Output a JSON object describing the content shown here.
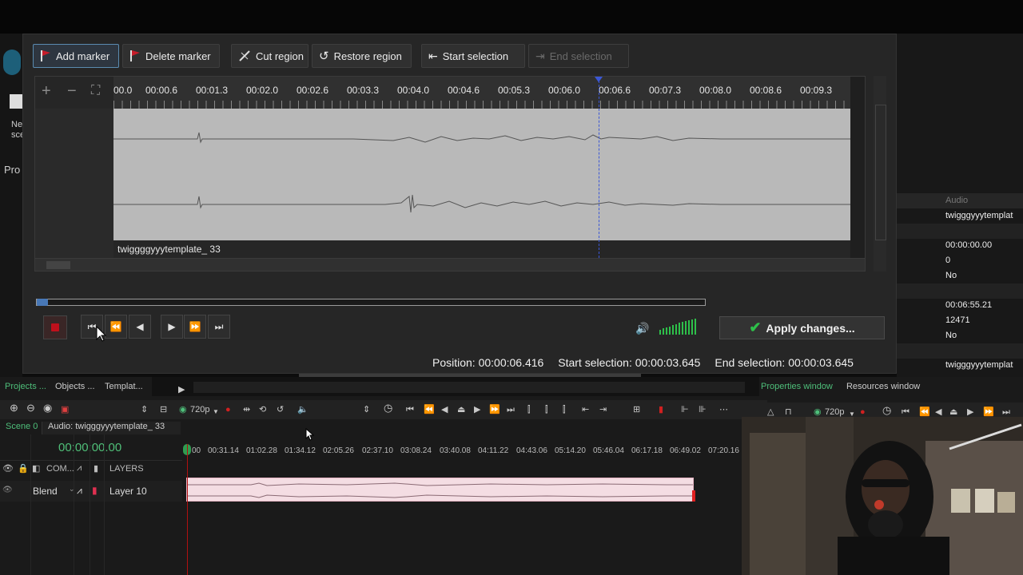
{
  "bg_left": {
    "sidebar_text": [
      "Ne",
      "sce",
      "Pro"
    ]
  },
  "bg_right": {
    "header": "Audio",
    "rows": [
      "twigggyyytemplat",
      "",
      "00:00:00.00",
      "0",
      "No",
      "",
      "00:06:55.21",
      "12471",
      "No",
      "",
      "twigggyyytemplat"
    ]
  },
  "toolbar": {
    "add_marker": "Add marker",
    "delete_marker": "Delete marker",
    "cut_region": "Cut region",
    "restore_region": "Restore region",
    "start_selection": "Start selection",
    "end_selection": "End selection"
  },
  "ruler": {
    "labels": [
      "00.0",
      "00:00.6",
      "00:01.3",
      "00:02.0",
      "00:02.6",
      "00:03.3",
      "00:04.0",
      "00:04.6",
      "00:05.3",
      "00:06.0",
      "00:06.6",
      "00:07.3",
      "00:08.0",
      "00:08.6",
      "00:09.3"
    ]
  },
  "track_label": "twiggggyyytemplate_ 33",
  "apply_button": "Apply changes...",
  "status": {
    "position": "Position: 00:00:06.416",
    "start_selection": "Start selection: 00:00:03.645",
    "end_selection": "End selection: 00:00:03.645"
  },
  "bottom": {
    "tabs": [
      "Projects ...",
      "Objects ...",
      "Templat..."
    ],
    "right_tabs": [
      "Properties window",
      "Resources window"
    ],
    "resolution": "720p",
    "resolution_right": "720p",
    "scene_tab": "Scene 0",
    "audio_tab": "Audio: twigggyyytemplate_ 33",
    "timecode": "00:00:00.00",
    "ruler": [
      "00",
      "00:31.14",
      "01:02.28",
      "01:34.12",
      "02:05.26",
      "02:37.10",
      "03:08.24",
      "03:40.08",
      "04:11.22",
      "04:43.06",
      "05:14.20",
      "05:46.04",
      "06:17.18",
      "06:49.02",
      "07:20.16"
    ],
    "layers_label": "LAYERS",
    "com_label": "COM...",
    "blend_label": "Blend",
    "layer_name": "Layer 10"
  },
  "colors": {
    "accent_blue": "#3b57d6",
    "green": "#4fbf78",
    "record_red": "#c0101c",
    "clip_pink": "#f4dde3"
  }
}
